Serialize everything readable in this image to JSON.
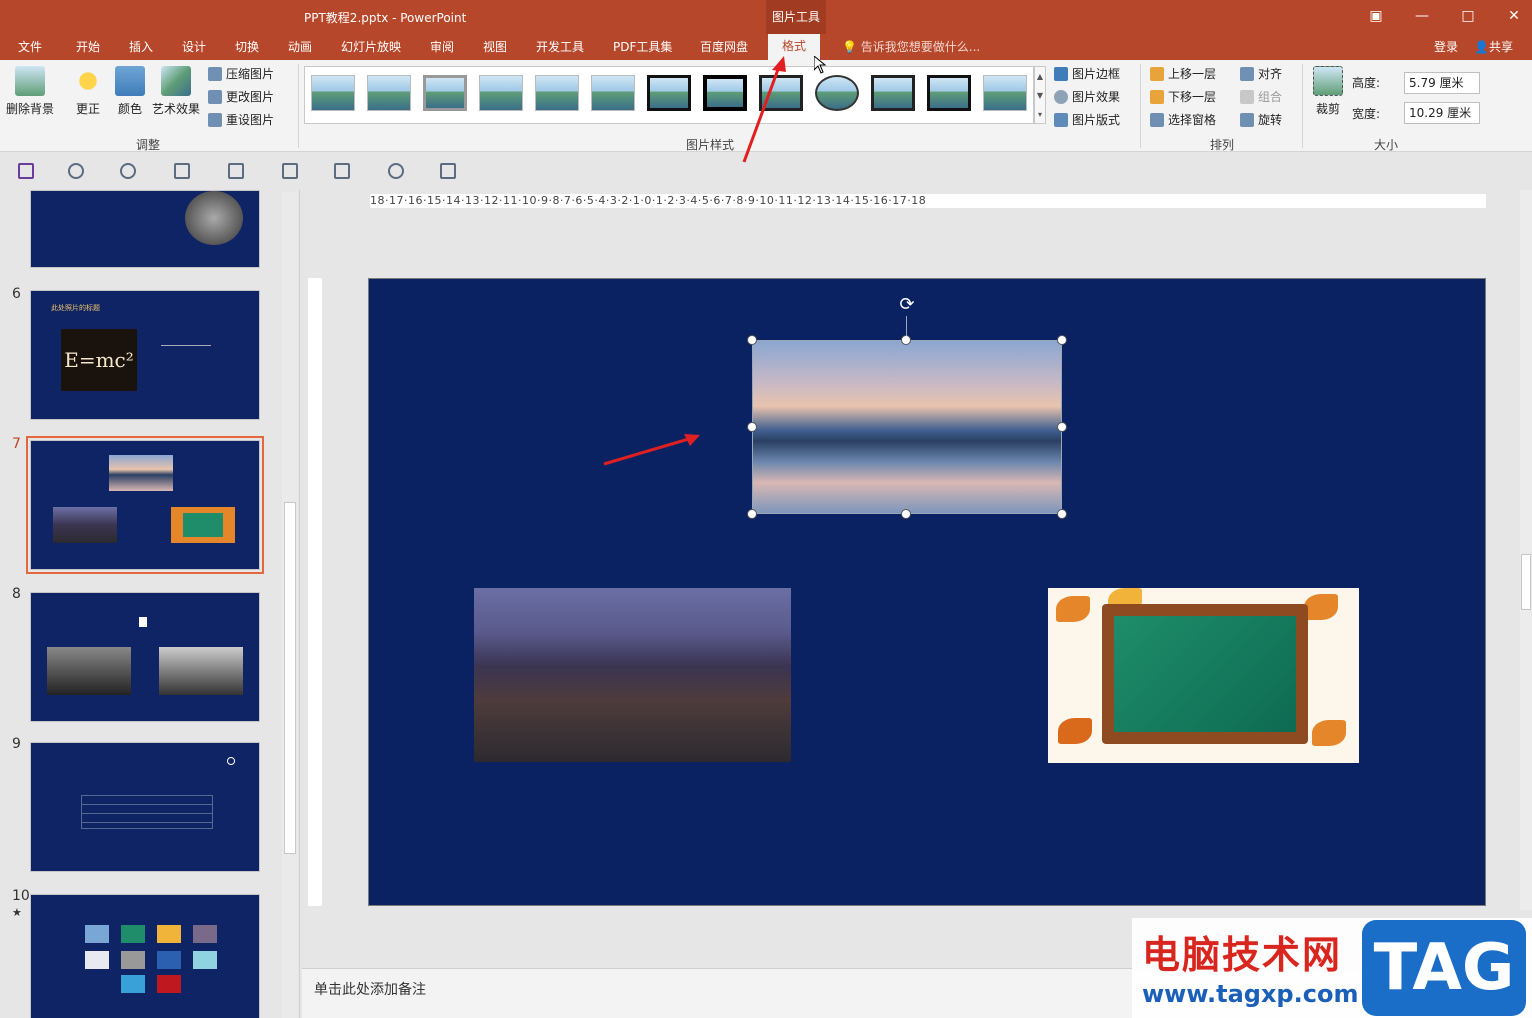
{
  "window": {
    "title": "PPT教程2.pptx - PowerPoint",
    "context_tool": "图片工具"
  },
  "tabs": [
    "文件",
    "开始",
    "插入",
    "设计",
    "切换",
    "动画",
    "幻灯片放映",
    "审阅",
    "视图",
    "开发工具",
    "PDF工具集",
    "百度网盘",
    "格式"
  ],
  "active_tab": "格式",
  "tellme": "告诉我您想要做什么...",
  "account": {
    "login": "登录",
    "share": "共享"
  },
  "ribbon": {
    "adjust": {
      "remove_bg": "删除背景",
      "correct": "更正",
      "color": "颜色",
      "art_effects": "艺术效果",
      "compress": "压缩图片",
      "change": "更改图片",
      "reset": "重设图片",
      "group_label": "调整"
    },
    "styles": {
      "border": "图片边框",
      "effects": "图片效果",
      "layout": "图片版式",
      "group_label": "图片样式"
    },
    "arrange": {
      "bring_forward": "上移一层",
      "send_backward": "下移一层",
      "selection_pane": "选择窗格",
      "align": "对齐",
      "group": "组合",
      "rotate": "旋转",
      "group_label": "排列"
    },
    "size": {
      "crop": "裁剪",
      "height_label": "高度:",
      "height_value": "5.79 厘米",
      "width_label": "宽度:",
      "width_value": "10.29 厘米",
      "group_label": "大小"
    }
  },
  "slides": {
    "numbers": [
      "6",
      "7",
      "8",
      "9",
      "10"
    ],
    "star": "★",
    "slide6_title": "此处照片的标题",
    "slide6_formula": "E=mc²",
    "selected": "7"
  },
  "ruler": {
    "horizontal": "18·17·16·15·14·13·12·11·10·9·8·7·6·5·4·3·2·1·0·1·2·3·4·5·6·7·8·9·10·11·12·13·14·15·16·17·18"
  },
  "notes_placeholder": "单击此处添加备注",
  "watermark": {
    "cn": "电脑技术网",
    "url": "www.tagxp.com",
    "tag": "TAG"
  },
  "colors": {
    "accent": "#b7472a",
    "slide_bg": "#0b2262",
    "arrow": "#e02020"
  }
}
